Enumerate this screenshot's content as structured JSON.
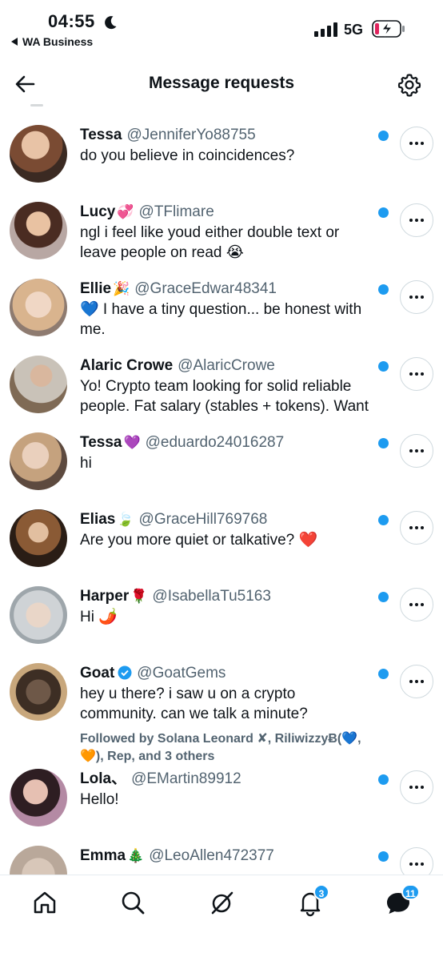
{
  "status_bar": {
    "time": "04:55",
    "back_app": "WA Business",
    "network": "5G"
  },
  "header": {
    "title": "Message requests"
  },
  "colors": {
    "accent": "#1d9bf0",
    "text": "#0f1419",
    "muted": "#536471"
  },
  "requests": [
    {
      "name": "Tessa",
      "name_emoji": "",
      "handle": "@JenniferYo88755",
      "message": "do you believe in coincidences?",
      "followed": "",
      "verified": false,
      "unread": true
    },
    {
      "name": "Lucy",
      "name_emoji": "💞",
      "handle": "@TFlimare",
      "message": "ngl i feel like youd either double text or leave people on read 😭",
      "followed": "",
      "verified": false,
      "unread": true
    },
    {
      "name": "Ellie",
      "name_emoji": "🎉",
      "handle": "@GraceEdwar48341",
      "message": "💙 I have a tiny question... be honest with me.",
      "followed": "",
      "verified": false,
      "unread": true
    },
    {
      "name": "Alaric Crowe",
      "name_emoji": "",
      "handle": "@AlaricCrowe",
      "message": "Yo! Crypto team looking for solid reliable people. Fat salary (stables + tokens). Want",
      "followed": "",
      "verified": false,
      "unread": true
    },
    {
      "name": "Tessa",
      "name_emoji": "💜",
      "handle": "@eduardo24016287",
      "message": "hi",
      "followed": "",
      "verified": false,
      "unread": true
    },
    {
      "name": "Elias",
      "name_emoji": "🍃",
      "handle": "@GraceHill769768",
      "message": "Are you more quiet or talkative? ❤️",
      "followed": "",
      "verified": false,
      "unread": true
    },
    {
      "name": "Harper",
      "name_emoji": "🌹",
      "handle": "@IsabellaTu5163",
      "message": "Hi 🌶️",
      "followed": "",
      "verified": false,
      "unread": true
    },
    {
      "name": "Goat",
      "name_emoji": "",
      "handle": "@GoatGems",
      "message": "hey u there? i saw u on a crypto community. can we talk a minute?",
      "followed": "Followed by Solana Leonard ✘, RiliwizzyɃ(💙, 🧡), Rep, and 3 others",
      "verified": true,
      "unread": true
    },
    {
      "name": "Lola、",
      "name_emoji": "",
      "handle": "@EMartin89912",
      "message": "Hello!",
      "followed": "",
      "verified": false,
      "unread": true
    },
    {
      "name": "Emma",
      "name_emoji": "🎄",
      "handle": "@LeoAllen472377",
      "message": "",
      "followed": "",
      "verified": false,
      "unread": true
    }
  ],
  "tab_bar": {
    "tabs": [
      "home-icon",
      "search-icon",
      "grok-icon",
      "notifications-icon",
      "messages-icon"
    ],
    "notifications_badge": "3",
    "messages_badge": "11"
  }
}
